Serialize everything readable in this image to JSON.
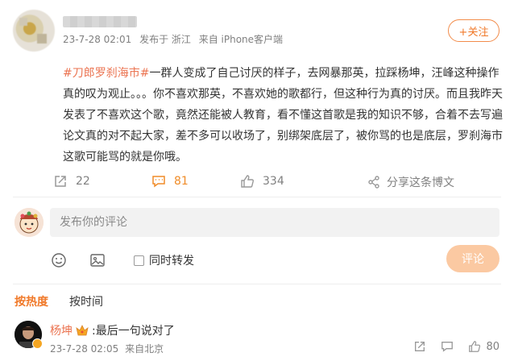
{
  "post": {
    "time": "23-7-28 02:01",
    "location": "发布于 浙江",
    "source": "来自 iPhone客户端",
    "follow_label": "+关注",
    "hashtag": "#刀郎罗刹海市#",
    "body": "一群人变成了自己讨厌的样子，去网暴那英，拉踩杨坤，汪峰这种操作真的叹为观止。。。你不喜欢那英，不喜欢她的歌都行，但这种行为真的讨厌。而且我昨天发表了不喜欢这个歌，竟然还能被人教育，看不懂这首歌是我的知识不够，合着不去写遍论文真的对不起大家，差不多可以收场了，别绑架底层了，被你骂的也是底层，罗刹海市这歌可能骂的就是你哦。"
  },
  "actions": {
    "repost_count": "22",
    "comment_count": "81",
    "like_count": "334",
    "share_label": "分享这条博文"
  },
  "composer": {
    "placeholder": "发布你的评论",
    "repost_label": "同时转发",
    "submit_label": "评论"
  },
  "sort": {
    "hot_label": "按热度",
    "time_label": "按时间"
  },
  "comment": {
    "author": "杨坤",
    "text": ":最后一句说对了",
    "time": "23-7-28 02:05",
    "location": "来自北京",
    "like_count": "80"
  },
  "colors": {
    "accent": "#f07828",
    "link": "#eb7350",
    "submit_disabled": "#fbc9a2",
    "muted": "#808080"
  }
}
